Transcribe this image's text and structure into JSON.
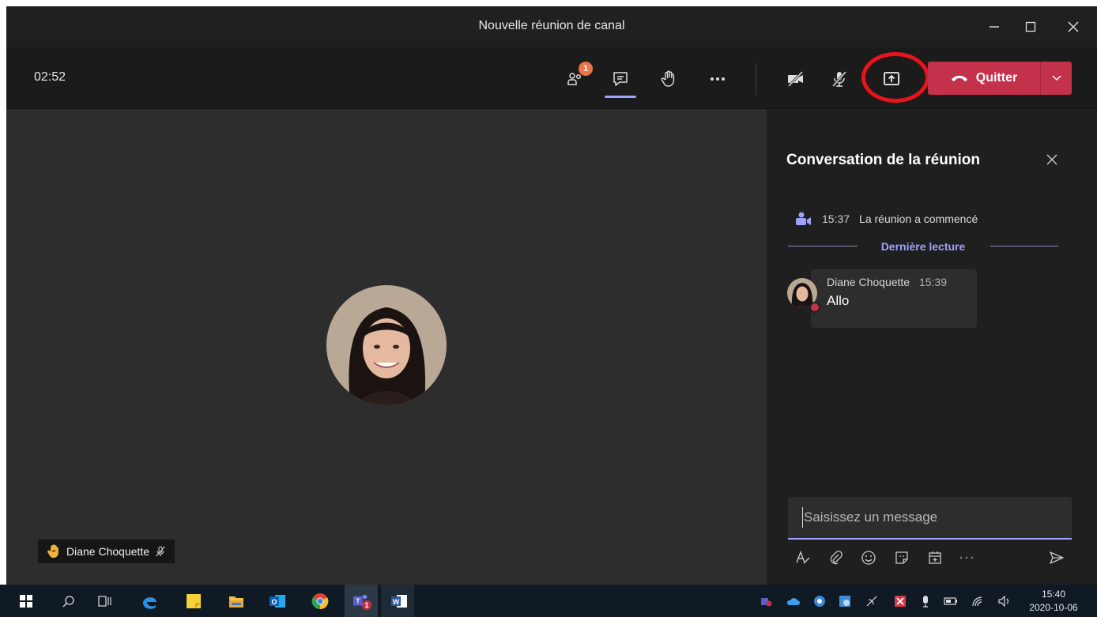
{
  "window": {
    "title": "Nouvelle réunion de canal",
    "controls": [
      "minimize-icon",
      "maximize-icon",
      "close-icon"
    ]
  },
  "toolbar": {
    "timer": "02:52",
    "participants_badge": "1",
    "quit_label": "Quitter",
    "accent_color": "#c4314b"
  },
  "stage": {
    "participant_name": "Diane Choquette"
  },
  "chat": {
    "title": "Conversation de la réunion",
    "event_time": "15:37",
    "event_text": "La réunion a commencé",
    "last_read_label": "Dernière lecture",
    "messages": [
      {
        "author": "Diane Choquette",
        "time": "15:39",
        "text": "Allo"
      }
    ],
    "compose_placeholder": "Saisissez un message",
    "accent_color": "#9ea2ff"
  },
  "taskbar": {
    "time": "15:40",
    "date": "2020-10-06",
    "teams_badge": "1"
  }
}
